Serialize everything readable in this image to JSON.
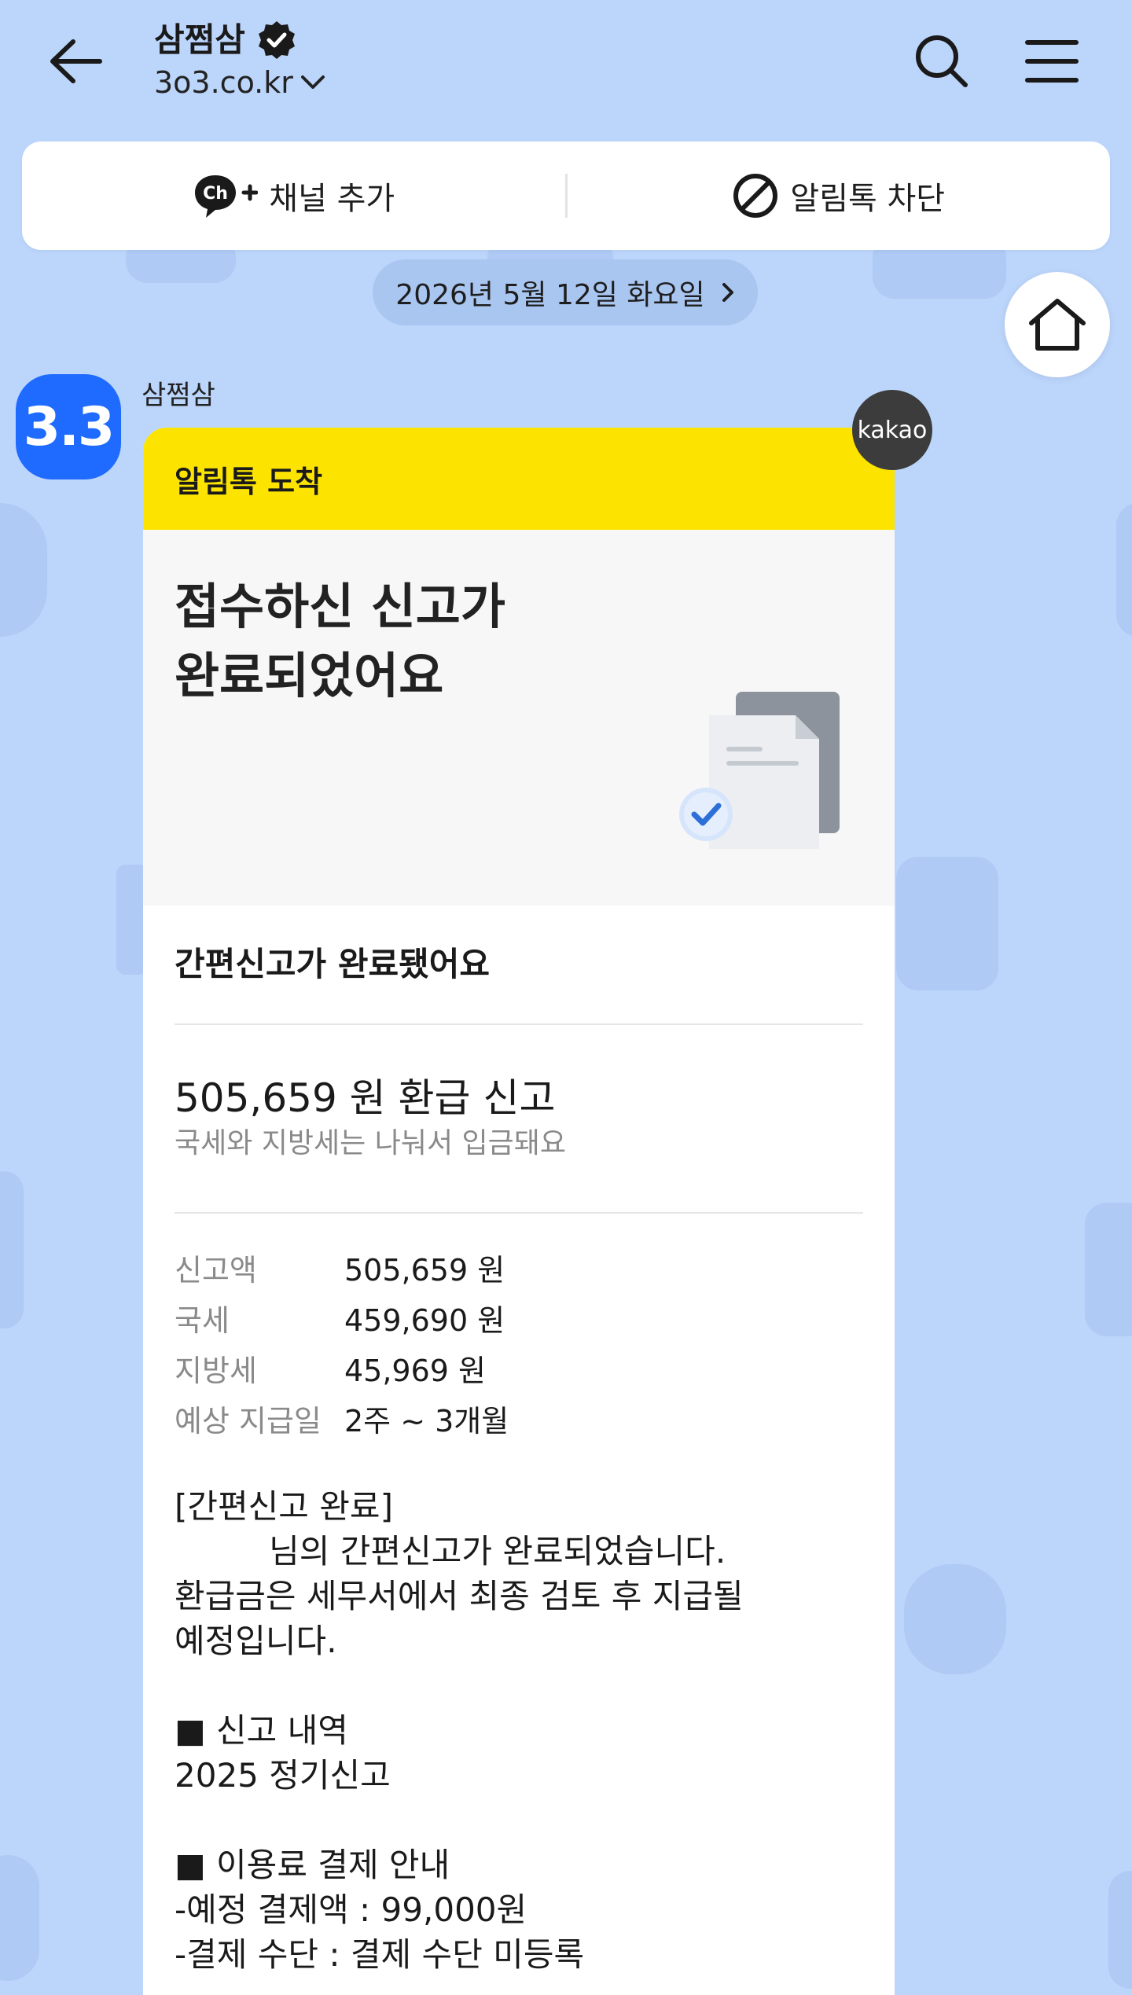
{
  "header": {
    "channel_name": "삼쩜삼",
    "domain": "3o3.co.kr"
  },
  "action_bar": {
    "add_channel_label": "채널 추가",
    "block_label": "알림톡 차단"
  },
  "date_divider": "2026년 5월 12일 화요일",
  "sender": {
    "name": "삼쩜삼",
    "avatar_text": "3.3"
  },
  "kakao_badge": "kakao",
  "card": {
    "header_label": "알림톡 도착",
    "hero_title_line1": "접수하신 신고가",
    "hero_title_line2": "완료되었어요",
    "section_title": "간편신고가 완료됐어요",
    "refund_amount": "505,659 원 환급 신고",
    "refund_note": "국세와 지방세는 나눠서 입금돼요",
    "details": [
      {
        "label": "신고액",
        "value": "505,659 원"
      },
      {
        "label": "국세",
        "value": "459,690 원"
      },
      {
        "label": "지방세",
        "value": "45,969 원"
      },
      {
        "label": "예상 지급일",
        "value": "2주 ~ 3개월"
      }
    ],
    "message": "[간편신고 완료]\n         님의 간편신고가 완료되었습니다.\n환급금은 세무서에서 최종 검토 후 지급될\n예정입니다.\n\n■ 신고 내역\n2025 정기신고\n\n■ 이용료 결제 안내\n-예정 결제액 : 99,000원\n-결제 수단 : 결제 수단 미등록"
  },
  "colors": {
    "background": "#bcd5fb",
    "card_header": "#fde400",
    "avatar": "#1f6bff"
  }
}
